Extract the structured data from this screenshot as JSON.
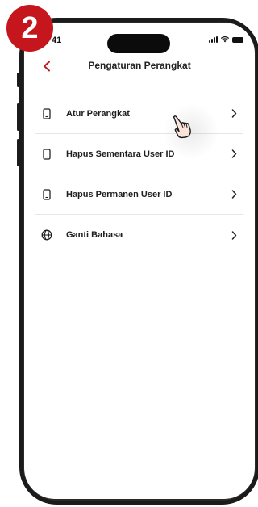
{
  "step_badge": "2",
  "status_bar": {
    "time": "41"
  },
  "header": {
    "title": "Pengaturan Perangkat"
  },
  "menu": {
    "items": [
      {
        "label": "Atur Perangkat",
        "icon": "phone-icon"
      },
      {
        "label": "Hapus Sementara User ID",
        "icon": "phone-icon"
      },
      {
        "label": "Hapus Permanen User ID",
        "icon": "phone-icon"
      },
      {
        "label": "Ganti Bahasa",
        "icon": "globe-icon"
      }
    ]
  },
  "colors": {
    "accent": "#c4161c",
    "text": "#1f1f1f",
    "divider": "#e6e6e6"
  }
}
